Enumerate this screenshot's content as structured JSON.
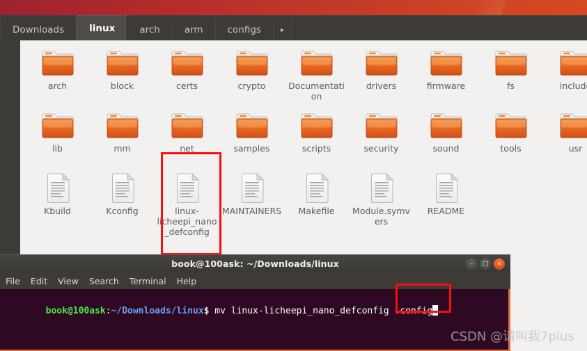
{
  "desktop": {
    "wallpaper_color": "#c0392a"
  },
  "file_manager": {
    "breadcrumbs": [
      {
        "label": "Downloads",
        "active": false
      },
      {
        "label": "linux",
        "active": true
      },
      {
        "label": "arch",
        "active": false
      },
      {
        "label": "arm",
        "active": false
      },
      {
        "label": "configs",
        "active": false
      }
    ],
    "overflow_arrow": "▸",
    "items": [
      {
        "name": "arch",
        "type": "folder"
      },
      {
        "name": "block",
        "type": "folder"
      },
      {
        "name": "certs",
        "type": "folder"
      },
      {
        "name": "crypto",
        "type": "folder"
      },
      {
        "name": "Documentation",
        "type": "folder"
      },
      {
        "name": "drivers",
        "type": "folder"
      },
      {
        "name": "firmware",
        "type": "folder"
      },
      {
        "name": "fs",
        "type": "folder"
      },
      {
        "name": "include",
        "type": "folder"
      },
      {
        "name": "lib",
        "type": "folder"
      },
      {
        "name": "mm",
        "type": "folder"
      },
      {
        "name": "net",
        "type": "folder"
      },
      {
        "name": "samples",
        "type": "folder"
      },
      {
        "name": "scripts",
        "type": "folder"
      },
      {
        "name": "security",
        "type": "folder"
      },
      {
        "name": "sound",
        "type": "folder"
      },
      {
        "name": "tools",
        "type": "folder"
      },
      {
        "name": "usr",
        "type": "folder"
      },
      {
        "name": "Kbuild",
        "type": "file"
      },
      {
        "name": "Kconfig",
        "type": "file"
      },
      {
        "name": "linux-licheepi_nano_defconfig",
        "type": "file",
        "highlighted": true
      },
      {
        "name": "MAINTAINERS",
        "type": "file"
      },
      {
        "name": "Makefile",
        "type": "file"
      },
      {
        "name": "Module.symvers",
        "type": "file"
      },
      {
        "name": "README",
        "type": "file"
      }
    ]
  },
  "terminal": {
    "title": "book@100ask: ~/Downloads/linux",
    "menu": [
      "File",
      "Edit",
      "View",
      "Search",
      "Terminal",
      "Help"
    ],
    "window_buttons": {
      "minimize": "–",
      "maximize": "□",
      "close": "×"
    },
    "prompt": {
      "user_host": "book@100ask",
      "separator": ":",
      "path": "~/Downloads/linux",
      "dollar": "$"
    },
    "command": " mv linux-licheepi_nano_defconfig .config",
    "command_prefix": " mv linux-licheepi_nano_defconfig",
    "command_target": " .config",
    "colors": {
      "background": "#2d0922",
      "prompt_user": "#4ee64e",
      "prompt_path": "#6a9ef5",
      "border": "#e06b3a"
    }
  },
  "annotations": {
    "box_color": "#fc0d0d",
    "highlighted_file": "linux-licheepi_nano_defconfig",
    "highlighted_command_arg": ".config"
  },
  "watermark": {
    "text": "CSDN @请叫我7plus"
  }
}
